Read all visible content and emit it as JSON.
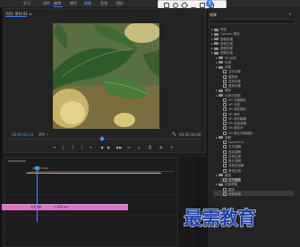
{
  "menu": {
    "items": [
      {
        "label": "学习"
      },
      {
        "label": "组件"
      },
      {
        "label": "编辑"
      },
      {
        "label": "颜色"
      },
      {
        "label": "效果"
      },
      {
        "label": "音频"
      },
      {
        "label": "图形"
      }
    ],
    "active_label": "效果"
  },
  "float_toolbar": {
    "badge": "3"
  },
  "monitor": {
    "tab_label": "节目: 序列 01 ≡",
    "timecode_current": "00:00:04:22",
    "fit_label": "适合",
    "timecode_duration": "00:00:10:00",
    "transport_buttons": [
      {
        "icon": "mark-in-icon",
        "glyph": "▾"
      },
      {
        "icon": "mark-out-icon",
        "glyph": "|"
      },
      {
        "icon": "marker-icon",
        "glyph": "{"
      },
      {
        "icon": "goto-in-icon",
        "glyph": "}"
      },
      {
        "icon": "step-back-icon",
        "glyph": "⇤"
      },
      {
        "icon": "play-icon",
        "glyph": "◀"
      },
      {
        "icon": "step-forward-icon",
        "glyph": "▶"
      },
      {
        "icon": "goto-out-icon",
        "glyph": "▶▶"
      },
      {
        "icon": "lift-icon",
        "glyph": "⇥"
      },
      {
        "icon": "extract-icon",
        "glyph": "⌂"
      },
      {
        "icon": "export-frame-icon",
        "glyph": "⎘"
      },
      {
        "icon": "compare-icon",
        "glyph": "⊞"
      },
      {
        "icon": "settings-icon",
        "glyph": "+"
      }
    ]
  },
  "timeline": {
    "timecode": "00:00:05:00",
    "clip_label": "交叉溶解",
    "clip_name": "fx 花朵.jpg"
  },
  "effects": {
    "title": "效果",
    "menu_icon": "≡",
    "items": [
      {
        "label": "预设",
        "indent": 0,
        "type": "folder"
      },
      {
        "label": "Lumetri 预设",
        "indent": 0,
        "type": "folder"
      },
      {
        "label": "音频效果",
        "indent": 0,
        "type": "folder"
      },
      {
        "label": "音频过渡",
        "indent": 0,
        "type": "folder"
      },
      {
        "label": "视频效果",
        "indent": 0,
        "type": "folder"
      },
      {
        "label": "视频过渡",
        "indent": 0,
        "type": "folder"
      },
      {
        "label": "3D 运动",
        "indent": 1,
        "type": "folder"
      },
      {
        "label": "内滑",
        "indent": 1,
        "type": "folder"
      },
      {
        "label": "划像",
        "indent": 1,
        "type": "folder"
      },
      {
        "label": "交叉划像",
        "indent": 2,
        "type": "file"
      },
      {
        "label": "圆划像",
        "indent": 2,
        "type": "file"
      },
      {
        "label": "盒形划像",
        "indent": 2,
        "type": "file"
      },
      {
        "label": "菱形划像",
        "indent": 2,
        "type": "file"
      },
      {
        "label": "擦除",
        "indent": 1,
        "type": "folder"
      },
      {
        "label": "沉浸式视频",
        "indent": 1,
        "type": "folder"
      },
      {
        "label": "VR 光圈擦除",
        "indent": 2,
        "type": "file"
      },
      {
        "label": "VR 光线",
        "indent": 2,
        "type": "file"
      },
      {
        "label": "VR 渐变擦除",
        "indent": 2,
        "type": "file"
      },
      {
        "label": "VR 漏光",
        "indent": 2,
        "type": "file"
      },
      {
        "label": "VR 球形模糊",
        "indent": 2,
        "type": "file"
      },
      {
        "label": "VR 色度泄漏",
        "indent": 2,
        "type": "file"
      },
      {
        "label": "VR 随机块",
        "indent": 2,
        "type": "file"
      },
      {
        "label": "VR 默比乌斯缩放",
        "indent": 2,
        "type": "file"
      },
      {
        "label": "溶解",
        "indent": 1,
        "type": "folder"
      },
      {
        "label": "MorphCut",
        "indent": 2,
        "type": "file"
      },
      {
        "label": "交叉溶解",
        "indent": 2,
        "type": "file"
      },
      {
        "label": "叠加溶解",
        "indent": 2,
        "type": "file"
      },
      {
        "label": "白场过渡",
        "indent": 2,
        "type": "file"
      },
      {
        "label": "胶片溶解",
        "indent": 2,
        "type": "file"
      },
      {
        "label": "非叠加溶解",
        "indent": 2,
        "type": "file"
      },
      {
        "label": "黑场过渡",
        "indent": 2,
        "type": "file"
      },
      {
        "label": "缩放",
        "indent": 1,
        "type": "folder"
      },
      {
        "label": "交叉缩放",
        "indent": 2,
        "type": "file",
        "selected": true
      },
      {
        "label": "页面剥落",
        "indent": 1,
        "type": "folder"
      },
      {
        "label": "翻页",
        "indent": 2,
        "type": "file"
      },
      {
        "label": "页面剥落",
        "indent": 2,
        "type": "file"
      }
    ]
  },
  "watermark": "最需教育",
  "colors": {
    "accent": "#3b7bff",
    "clip": "#d675c9",
    "watermark": "#1f3fa8",
    "panel_bg": "#232323"
  }
}
